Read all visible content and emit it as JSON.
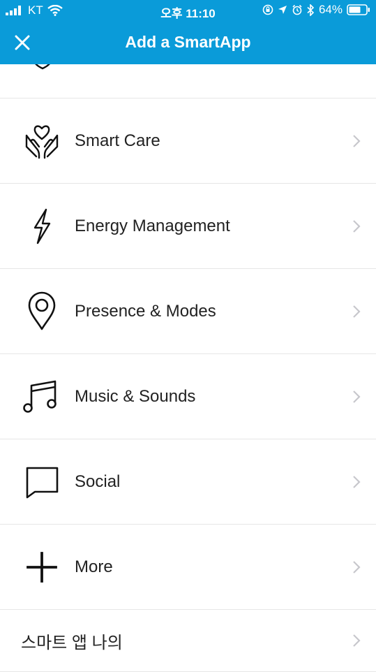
{
  "status_bar": {
    "carrier": "KT",
    "time": "오후 11:10",
    "battery": "64%"
  },
  "header": {
    "title": "Add a SmartApp",
    "close_icon": "close-icon"
  },
  "colors": {
    "header_bg": "#0a9bd9",
    "divider": "#e6e6e6",
    "text": "#222222",
    "chevron": "#c7c7cc"
  },
  "categories": [
    {
      "label": "Smart Care",
      "icon": "hands-heart-icon"
    },
    {
      "label": "Energy Management",
      "icon": "lightning-bolt-icon"
    },
    {
      "label": "Presence & Modes",
      "icon": "location-pin-icon"
    },
    {
      "label": "Music & Sounds",
      "icon": "music-note-icon"
    },
    {
      "label": "Social",
      "icon": "chat-bubble-icon"
    },
    {
      "label": "More",
      "icon": "plus-icon"
    }
  ],
  "my_apps": {
    "label": "스마트 앱 나의"
  }
}
